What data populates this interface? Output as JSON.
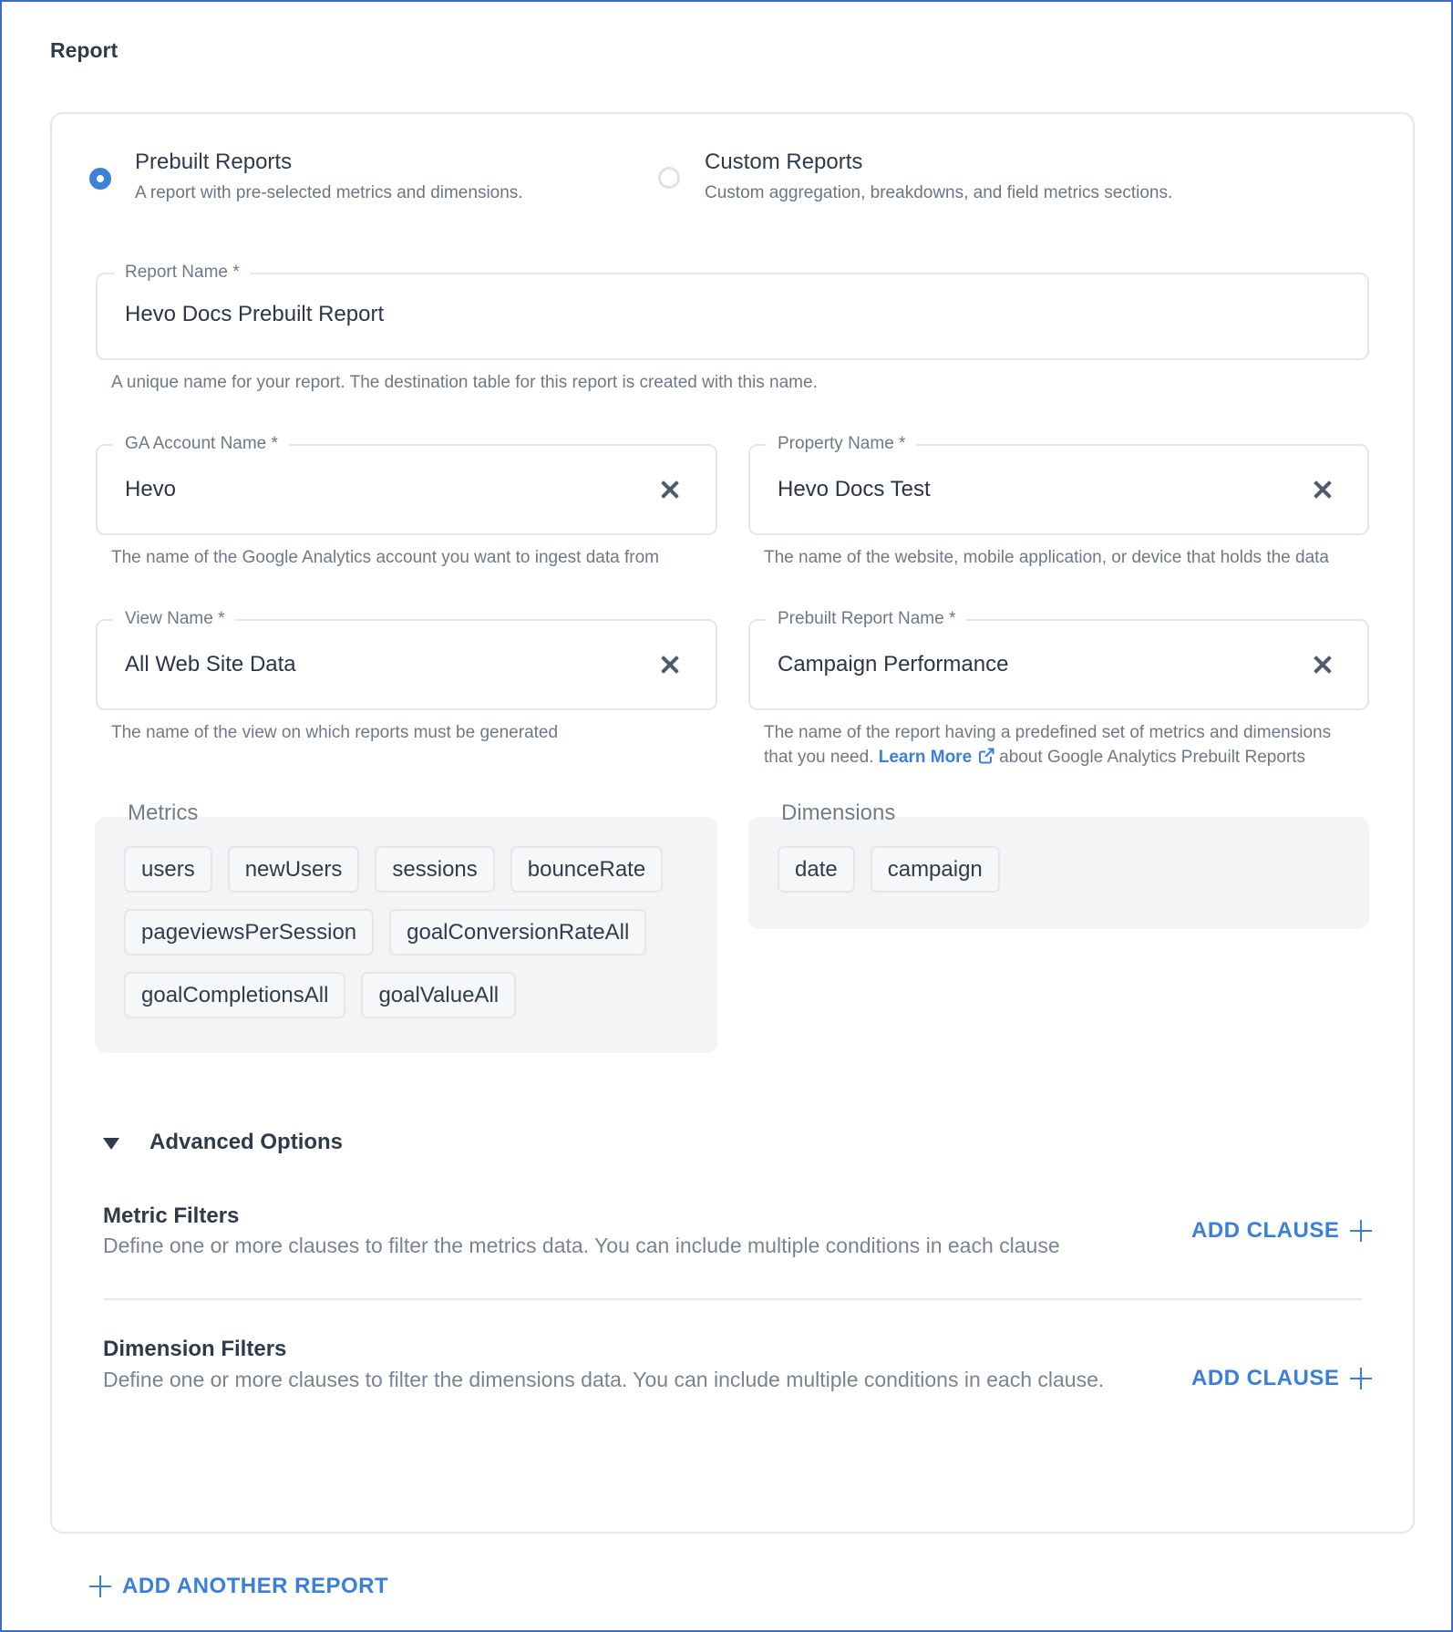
{
  "section_title": "Report",
  "report_type": {
    "selected": "prebuilt",
    "options": [
      {
        "id": "prebuilt",
        "title": "Prebuilt Reports",
        "description": "A report with pre-selected metrics and dimensions.",
        "selected": true
      },
      {
        "id": "custom",
        "title": "Custom Reports",
        "description": "Custom aggregation, breakdowns, and field metrics sections.",
        "selected": false
      }
    ]
  },
  "fields": {
    "report_name": {
      "label": "Report Name *",
      "value": "Hevo Docs Prebuilt Report",
      "helper": "A unique name for your report. The destination table for this report is created with this name."
    },
    "ga_account": {
      "label": "GA Account Name *",
      "value": "Hevo",
      "helper": "The name of the Google Analytics account you want to ingest data from"
    },
    "property": {
      "label": "Property Name *",
      "value": "Hevo Docs Test",
      "helper": "The name of the website, mobile application, or device that holds the data"
    },
    "view": {
      "label": "View Name *",
      "value": "All Web Site Data",
      "helper": "The name of the view on which reports must be generated"
    },
    "prebuilt_report": {
      "label": "Prebuilt Report Name *",
      "value": "Campaign Performance",
      "helper_before": "The name of the report having a predefined set of metrics and dimensions that you need.",
      "helper_link": "Learn More",
      "helper_after": "about Google Analytics Prebuilt Reports"
    }
  },
  "metrics": {
    "label": "Metrics",
    "items": [
      "users",
      "newUsers",
      "sessions",
      "bounceRate",
      "pageviewsPerSession",
      "goalConversionRateAll",
      "goalCompletionsAll",
      "goalValueAll"
    ]
  },
  "dimensions": {
    "label": "Dimensions",
    "items": [
      "date",
      "campaign"
    ]
  },
  "advanced": {
    "label": "Advanced Options",
    "expanded": true,
    "metric_filters": {
      "title": "Metric Filters",
      "description": "Define one or more clauses to filter the metrics data. You can include multiple conditions in each clause",
      "action": "ADD CLAUSE"
    },
    "dimension_filters": {
      "title": "Dimension Filters",
      "description": "Define one or more clauses to filter the dimensions data. You can include multiple conditions in each clause.",
      "action": "ADD CLAUSE"
    }
  },
  "add_another_report": "ADD ANOTHER REPORT",
  "colors": {
    "accent": "#3a7fdc",
    "frame": "#3e6bc5",
    "text": "#2f3a4c",
    "muted": "#6f7888"
  }
}
